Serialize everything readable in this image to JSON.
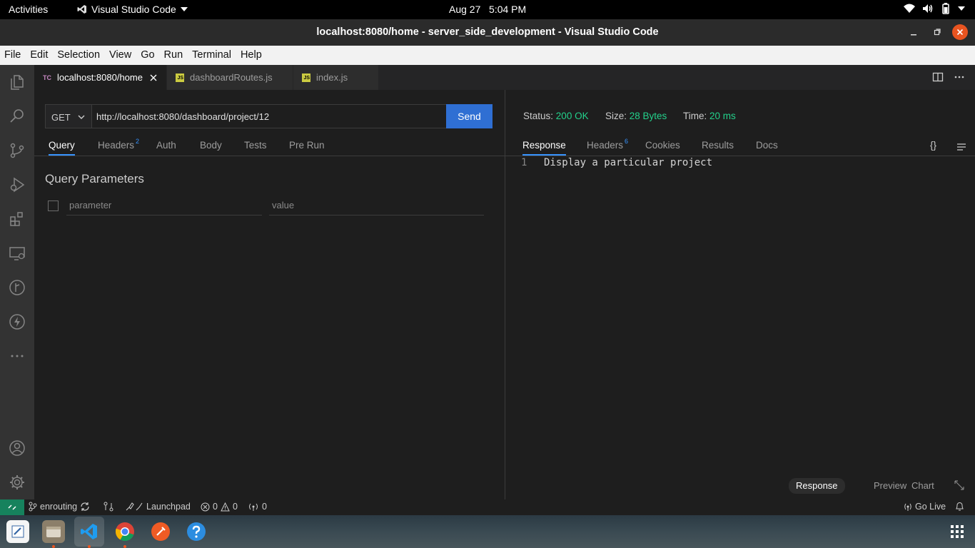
{
  "topbar": {
    "activities": "Activities",
    "app_name": "Visual Studio Code",
    "date": "Aug 27",
    "time": "5:04 PM"
  },
  "window": {
    "title": "localhost:8080/home - server_side_development - Visual Studio Code"
  },
  "menu": [
    "File",
    "Edit",
    "Selection",
    "View",
    "Go",
    "Run",
    "Terminal",
    "Help"
  ],
  "tabs": [
    {
      "icon_text": "TC",
      "label": "localhost:8080/home",
      "active": true
    },
    {
      "icon_text": "JS",
      "label": "dashboardRoutes.js",
      "active": false
    },
    {
      "icon_text": "JS",
      "label": "index.js",
      "active": false
    }
  ],
  "request": {
    "method": "GET",
    "url": "http://localhost:8080/dashboard/project/12",
    "send_label": "Send",
    "tabs": {
      "query": "Query",
      "headers": "Headers",
      "headers_count": "2",
      "auth": "Auth",
      "body": "Body",
      "tests": "Tests",
      "pre_run": "Pre Run"
    },
    "query_title": "Query Parameters",
    "param_placeholder": "parameter",
    "value_placeholder": "value"
  },
  "response": {
    "status_label": "Status:",
    "status_value": "200 OK",
    "size_label": "Size:",
    "size_value": "28 Bytes",
    "time_label": "Time:",
    "time_value": "20 ms",
    "tabs": {
      "response": "Response",
      "headers": "Headers",
      "headers_count": "6",
      "cookies": "Cookies",
      "results": "Results",
      "docs": "Docs"
    },
    "braces": "{}",
    "line_number": "1",
    "body_line": "Display a particular project",
    "bottom_tabs": {
      "response": "Response",
      "preview": "Preview",
      "chart": "Chart"
    }
  },
  "statusbar": {
    "branch": "enrouting",
    "launchpad": "Launchpad",
    "errors": "0",
    "warnings": "0",
    "ports": "0",
    "golive": "Go Live"
  },
  "colors": {
    "accent": "#3794ff",
    "send_button": "#2f6fd3",
    "success": "#23d18b",
    "ubuntu_orange": "#e95420",
    "remote": "#16825d"
  }
}
